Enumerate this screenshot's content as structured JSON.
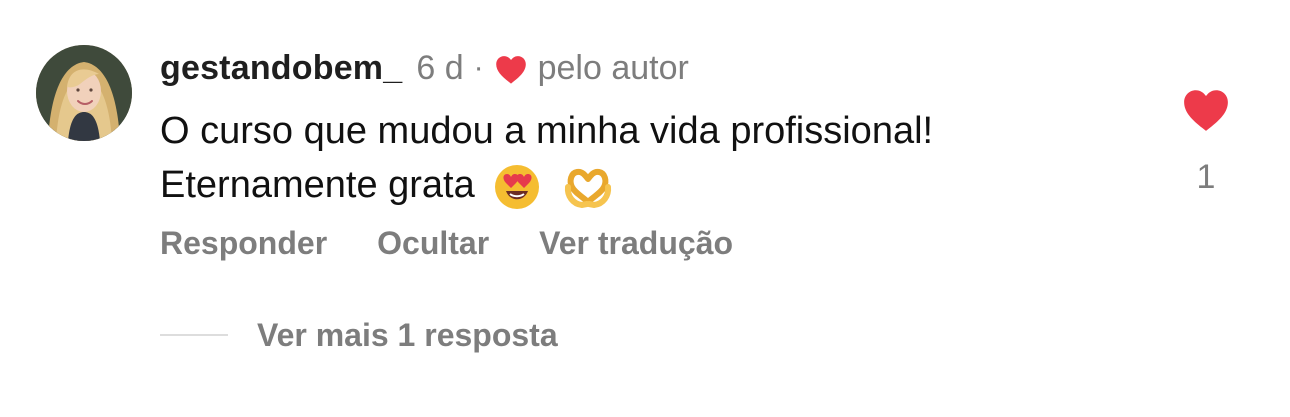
{
  "comment": {
    "username": "gestandobem_",
    "time": "6 d",
    "separator": "·",
    "author_badge_text": "pelo autor",
    "text_line_1": "O curso que mudou a minha vida profissional!",
    "text_line_2": "Eternamente grata",
    "emojis": [
      "heart-eyes-emoji",
      "heart-hands-emoji"
    ],
    "like_count": "1",
    "actions": {
      "reply": "Responder",
      "hide": "Ocultar",
      "translate": "Ver tradução"
    },
    "view_replies": "Ver mais 1 resposta"
  },
  "icons": {
    "author_liked": "heart-icon",
    "like": "heart-icon"
  },
  "colors": {
    "like_red": "#ed3a4a",
    "muted_text": "#7d7d7d",
    "divider": "#dddddd"
  }
}
